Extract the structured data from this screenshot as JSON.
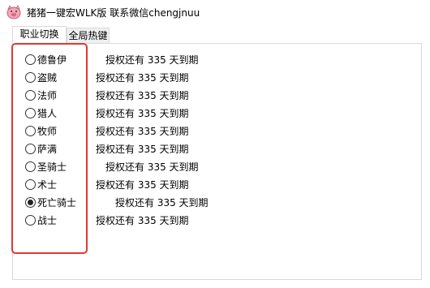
{
  "window": {
    "title": "猪猪一键宏WLK版 联系微信chengjnuu"
  },
  "tabs": [
    {
      "label": "职业切换",
      "active": true
    },
    {
      "label": "全局热键",
      "active": false
    }
  ],
  "classes": [
    {
      "name": "德鲁伊",
      "license": "授权还有 335 天到期",
      "checked": false
    },
    {
      "name": "盗贼",
      "license": "授权还有 335 天到期",
      "checked": false
    },
    {
      "name": "法师",
      "license": "授权还有 335 天到期",
      "checked": false
    },
    {
      "name": "猎人",
      "license": "授权还有 335 天到期",
      "checked": false
    },
    {
      "name": "牧师",
      "license": "授权还有 335 天到期",
      "checked": false
    },
    {
      "name": "萨满",
      "license": "授权还有 335 天到期",
      "checked": false
    },
    {
      "name": "圣骑士",
      "license": "授权还有 335 天到期",
      "checked": false
    },
    {
      "name": "术士",
      "license": "授权还有 335 天到期",
      "checked": false
    },
    {
      "name": "死亡骑士",
      "license": "授权还有 335 天到期",
      "checked": true
    },
    {
      "name": "战士",
      "license": "授权还有 335 天到期",
      "checked": false
    }
  ],
  "colors": {
    "highlight_border": "#e03a30"
  },
  "icons": {
    "app": "pig-face-icon"
  }
}
